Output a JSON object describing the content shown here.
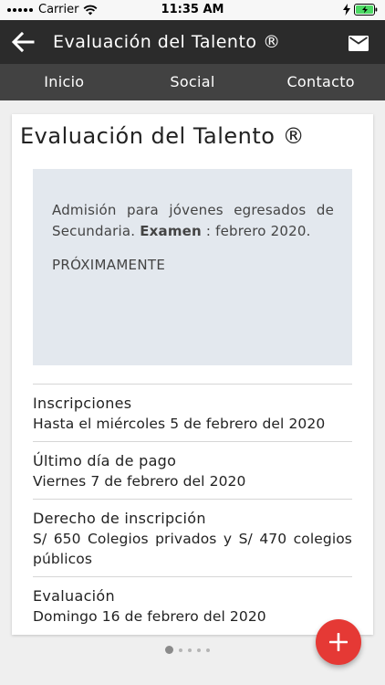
{
  "status_bar": {
    "carrier": "Carrier",
    "time": "11:35 AM",
    "icons": [
      "signal-icon",
      "wifi-icon",
      "charging-icon",
      "battery-icon"
    ]
  },
  "header": {
    "title": "Evaluación del Talento ®",
    "back_icon": "arrow-left-icon",
    "mail_icon": "mail-icon"
  },
  "tabs": [
    {
      "label": "Inicio"
    },
    {
      "label": "Social"
    },
    {
      "label": "Contacto"
    }
  ],
  "card": {
    "title": "Evaluación del Talento ®",
    "notice": {
      "text_before": "Admisión para jóvenes egresados de Secundaria. ",
      "bold": "Examen",
      "text_after": " : febrero 2020.",
      "status": "PRÓXIMAMENTE"
    },
    "items": [
      {
        "label": "Inscripciones",
        "value": "Hasta el miércoles 5 de febrero del 2020"
      },
      {
        "label": "Último día de pago",
        "value": "Viernes 7 de febrero del 2020"
      },
      {
        "label": "Derecho de inscripción",
        "value": "S/ 650 Colegios privados y S/ 470 colegios públicos"
      },
      {
        "label": "Evaluación",
        "value": "Domingo 16 de febrero del 2020"
      }
    ]
  },
  "fab": {
    "icon": "plus-icon"
  },
  "pager": {
    "page_count": 5,
    "active_index": 0
  },
  "colors": {
    "header_bg": "#2b2b2b",
    "tabs_bg": "#424242",
    "notice_bg": "#e3e8ee",
    "fab_bg": "#e53935"
  }
}
